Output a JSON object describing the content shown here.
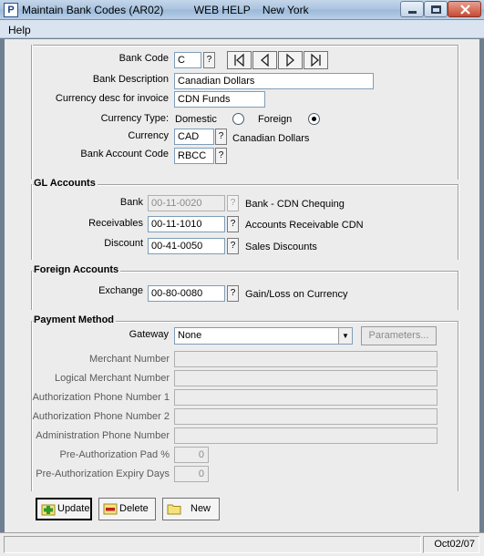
{
  "window": {
    "title": "Maintain Bank Codes (AR02)",
    "context": "WEB HELP    New York",
    "app_icon": "P"
  },
  "menu": {
    "help": "Help"
  },
  "bank": {
    "code_label": "Bank Code",
    "code_value": "C",
    "description_label": "Bank Description",
    "description_value": "Canadian Dollars",
    "currency_desc_label": "Currency desc for invoice",
    "currency_desc_value": "CDN Funds",
    "currency_type_label": "Currency Type:",
    "domestic_label": "Domestic",
    "foreign_label": "Foreign",
    "selected_currency_type": "Foreign",
    "currency_label": "Currency",
    "currency_value": "CAD",
    "currency_name": "Canadian Dollars",
    "account_code_label": "Bank Account Code",
    "account_code_value": "RBCC"
  },
  "nav": {
    "first": "first-record-icon",
    "prev": "previous-record-icon",
    "next": "next-record-icon",
    "last": "last-record-icon"
  },
  "gl": {
    "title": "GL Accounts",
    "bank_label": "Bank",
    "bank_value": "00-11-0020",
    "bank_desc": "Bank - CDN Chequing",
    "receivables_label": "Receivables",
    "receivables_value": "00-11-1010",
    "receivables_desc": "Accounts Receivable CDN",
    "discount_label": "Discount",
    "discount_value": "00-41-0050",
    "discount_desc": "Sales Discounts"
  },
  "foreign": {
    "title": "Foreign Accounts",
    "exchange_label": "Exchange",
    "exchange_value": "00-80-0080",
    "exchange_desc": "Gain/Loss on Currency"
  },
  "payment": {
    "title": "Payment Method",
    "gateway_label": "Gateway",
    "gateway_value": "None",
    "parameters_label": "Parameters...",
    "merchant_number_label": "Merchant Number",
    "logical_merchant_label": "Logical Merchant Number",
    "auth_phone1_label": "Authorization Phone Number 1",
    "auth_phone2_label": "Authorization Phone Number 2",
    "admin_phone_label": "Administration Phone Number",
    "pre_auth_pad_label": "Pre-Authorization Pad %",
    "pre_auth_pad_value": "0",
    "pre_auth_expiry_label": "Pre-Authorization Expiry Days",
    "pre_auth_expiry_value": "0"
  },
  "lookup_symbol": "?",
  "actions": {
    "update": "Update",
    "delete": "Delete",
    "new": "New"
  },
  "status": {
    "date": "Oct02/07"
  },
  "colors": {
    "title_gradient_top": "#c4d7ea",
    "dialog_bg": "#ececec",
    "field_border": "#7f9db9"
  }
}
